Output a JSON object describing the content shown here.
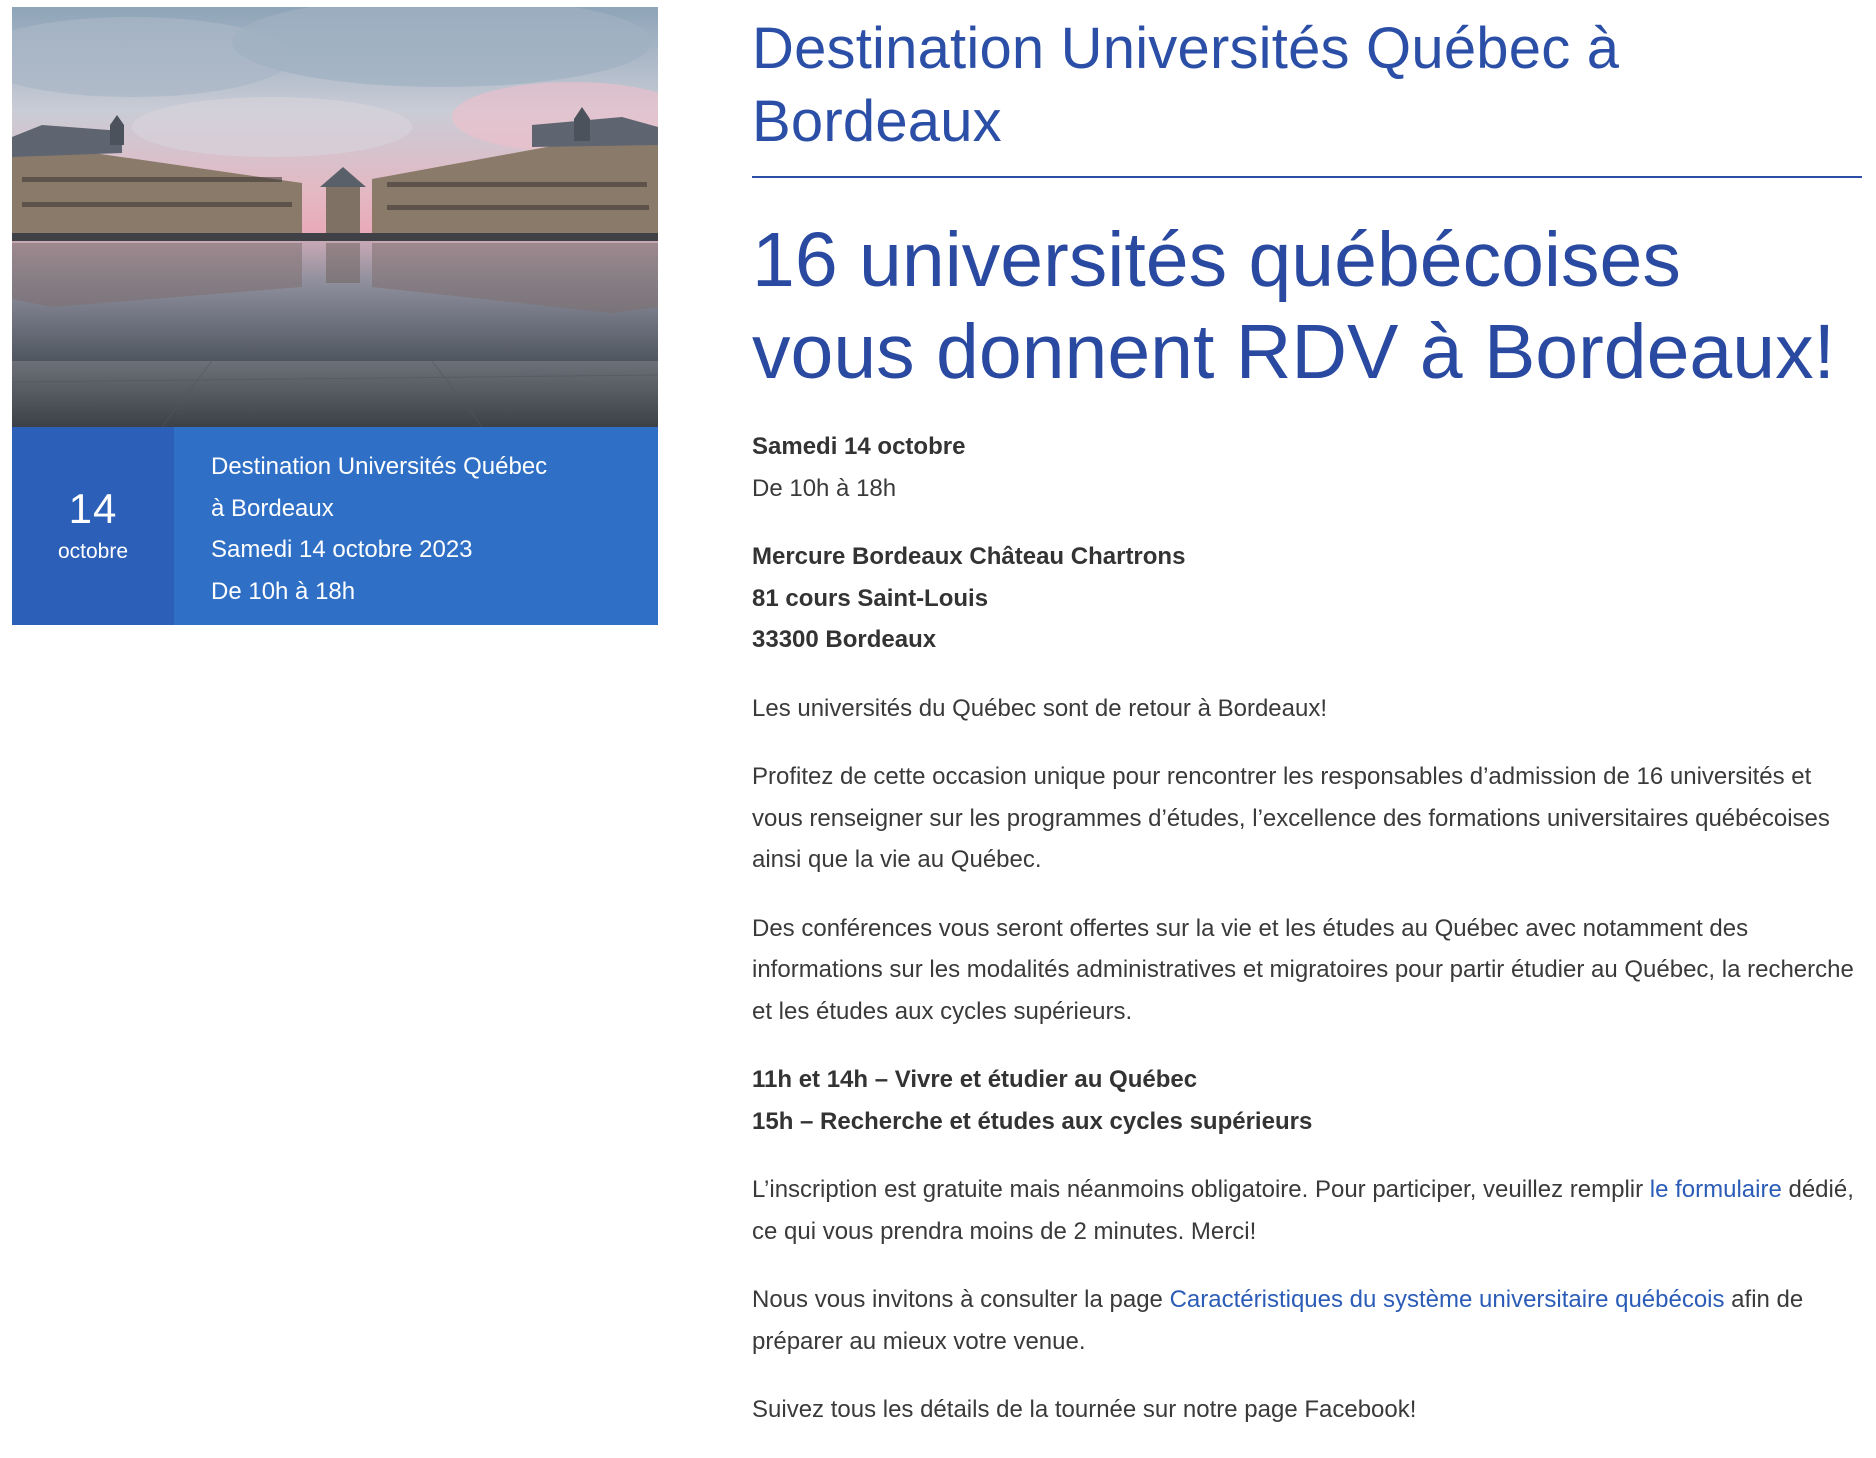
{
  "event_card": {
    "day": "14",
    "month": "octobre",
    "info_lines": [
      "Destination Universités Québec",
      "à Bordeaux",
      "Samedi 14 octobre 2023",
      "De 10h à 18h"
    ]
  },
  "page": {
    "title": "Destination Universités Québec à Bordeaux",
    "headline": "16 universités québécoises vous donnent RDV à Bordeaux!"
  },
  "content": {
    "date_bold": "Samedi 14 octobre",
    "hours": "De 10h à 18h",
    "venue_lines": [
      "Mercure Bordeaux Château Chartrons",
      "81 cours Saint-Louis",
      "33300 Bordeaux"
    ],
    "para_return": "Les universités du Québec sont de retour à Bordeaux!",
    "para_opportunity": "Profitez de cette occasion unique pour rencontrer les responsables d’admission de 16 universités et vous renseigner sur les programmes d’études, l’excellence des formations universitaires québécoises ainsi que la vie au Québec.",
    "para_conferences": "Des conférences vous seront offertes sur la vie et les études au Québec avec notamment des informations sur les modalités administratives et migratoires pour partir étudier au Québec, la recherche et les études aux cycles supérieurs.",
    "schedule_lines": [
      "11h et 14h – Vivre et étudier au Québec",
      "15h – Recherche et études aux cycles supérieurs"
    ],
    "registration_before": "L’inscription est gratuite mais néanmoins obligatoire. Pour participer, veuillez remplir ",
    "registration_link": "le formulaire",
    "registration_after": " dédié, ce qui vous prendra moins de 2 minutes. Merci!",
    "consult_before": "Nous vous invitons à consulter la page ",
    "consult_link": "Caractéristiques du système universitaire québécois",
    "consult_after": " afin de préparer au mieux votre venue.",
    "para_facebook": "Suivez tous les détails de la tournée sur notre page Facebook!"
  },
  "colors": {
    "brand_blue": "#2b4fa6",
    "card_blue": "#2f6fc5",
    "date_blue": "#2c5fb8",
    "link_blue": "#2b5cb7"
  }
}
